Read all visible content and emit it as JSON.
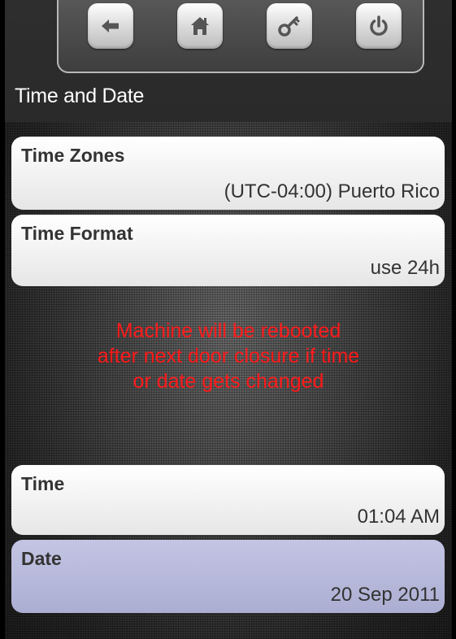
{
  "header": {
    "title": "Time and Date",
    "nav": [
      {
        "name": "back-icon"
      },
      {
        "name": "home-icon"
      },
      {
        "name": "key-icon"
      },
      {
        "name": "power-icon"
      }
    ]
  },
  "settings": {
    "time_zones": {
      "label": "Time Zones",
      "value": "(UTC-04:00) Puerto Rico"
    },
    "time_format": {
      "label": "Time Format",
      "value": "use 24h"
    },
    "time": {
      "label": "Time",
      "value": "01:04 AM"
    },
    "date": {
      "label": "Date",
      "value": "20 Sep 2011"
    }
  },
  "warning": {
    "line1": "Machine will be rebooted",
    "line2": "after next door closure if time",
    "line3": "or date gets changed",
    "color": "#ff1a1a"
  },
  "colors": {
    "selected_row": "#b4b6d8",
    "row": "#f2f2f2"
  }
}
